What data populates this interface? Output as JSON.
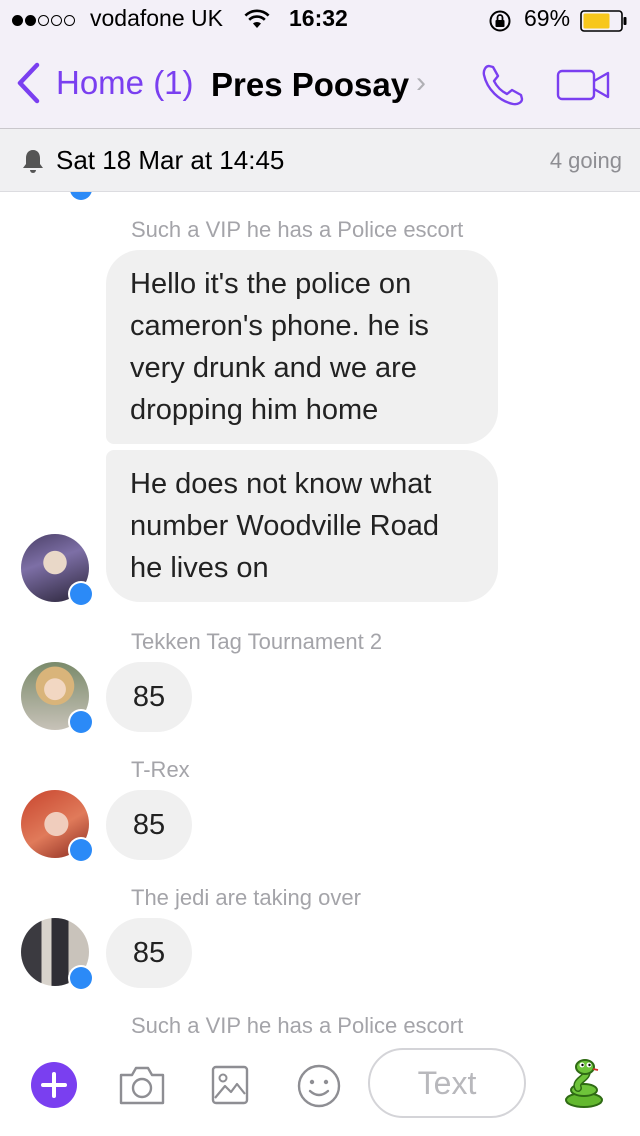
{
  "status_bar": {
    "carrier": "vodafone UK",
    "time": "16:32",
    "battery": "69%",
    "signal_bars_filled": 2,
    "signal_bars_total": 5
  },
  "nav": {
    "back_label": "Home (1)",
    "title": "Pres Poosay",
    "chevron": "›",
    "accent_color": "#7a3ff0"
  },
  "event": {
    "date": "Sat 18 Mar at 14:45",
    "going": "4 going"
  },
  "messages": [
    {
      "type": "caption",
      "text": "Such a VIP he has a Police escort"
    },
    {
      "type": "bubble",
      "lines": [
        "Hello it's the police on",
        "cameron's phone.  he is",
        "very drunk and we are",
        "dropping him home"
      ]
    },
    {
      "type": "bubble",
      "lines": [
        "He does not know what",
        "number Woodville Road",
        "he lives on"
      ]
    },
    {
      "type": "caption",
      "text": "Tekken Tag Tournament 2"
    },
    {
      "type": "bubble",
      "text": "85"
    },
    {
      "type": "caption",
      "text": "T-Rex"
    },
    {
      "type": "bubble",
      "text": "85"
    },
    {
      "type": "caption",
      "text": "The jedi are taking over"
    },
    {
      "type": "bubble",
      "text": "85"
    },
    {
      "type": "caption",
      "text": "Such a VIP he has a Police escort"
    }
  ],
  "toolbar": {
    "text_placeholder": "Text",
    "icons": [
      "plus-icon",
      "camera-icon",
      "gallery-icon",
      "emoji-icon",
      "snake-sticker-icon"
    ]
  }
}
